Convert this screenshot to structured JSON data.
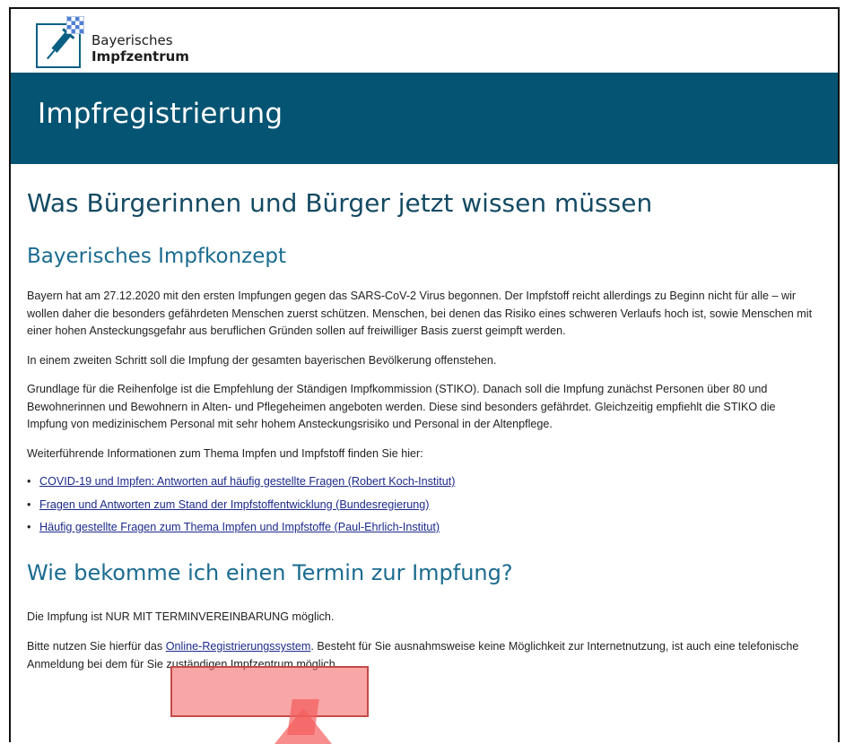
{
  "logo": {
    "line1": "Bayerisches",
    "line2": "Impfzentrum"
  },
  "banner": {
    "title": "Impfregistrierung"
  },
  "main": {
    "heading": "Was Bürgerinnen und Bürger jetzt wissen müssen",
    "section1": {
      "heading": "Bayerisches Impfkonzept",
      "p1": "Bayern hat am 27.12.2020 mit den ersten Impfungen gegen das SARS-CoV-2 Virus begonnen. Der Impfstoff reicht allerdings zu Beginn nicht für alle – wir wollen daher die besonders gefährdeten Menschen zuerst schützen. Menschen, bei denen das Risiko eines schweren Verlaufs hoch ist, sowie Menschen mit einer hohen Ansteckungsgefahr aus beruflichen Gründen sollen auf freiwilliger Basis zuerst geimpft werden.",
      "p2": "In einem zweiten Schritt soll die Impfung der gesamten bayerischen Bevölkerung offenstehen.",
      "p3": "Grundlage für die Reihenfolge ist die Empfehlung der Ständigen Impfkommission (STIKO). Danach soll die Impfung zunächst Personen über 80 und Bewohnerinnen und Bewohnern in Alten- und Pflegeheimen angeboten werden. Diese sind besonders gefährdet. Gleichzeitig empfiehlt die STIKO die Impfung von medizinischem Personal mit sehr hohem Ansteckungsrisiko und Personal in der Altenpflege.",
      "p4": "Weiterführende Informationen zum Thema Impfen und Impfstoff finden Sie hier:",
      "links": [
        "COVID-19 und Impfen: Antworten auf häufig gestellte Fragen (Robert Koch-Institut)",
        "Fragen und Antworten zum Stand der Impfstoffentwicklung (Bundesregierung)",
        "Häufig gestellte Fragen zum Thema Impfen und Impfstoffe (Paul-Ehrlich-Institut)"
      ]
    },
    "section2": {
      "heading": "Wie bekomme ich einen Termin zur Impfung?",
      "p1": "Die Impfung ist NUR MIT TERMINVEREINBARUNG möglich.",
      "p2_before": "Bitte nutzen Sie hierfür das ",
      "p2_link": "Online-Registrierungssystem",
      "p2_after": ". Besteht für Sie ausnahmsweise keine Möglichkeit zur Internetnutzung, ist auch eine telefonische Anmeldung bei dem für Sie zuständigen Impfzentrum möglich."
    }
  },
  "colors": {
    "banner": "#055473",
    "heading": "#144a63",
    "subheading": "#1a6b90",
    "link": "#1c2a8a",
    "highlight": "#f45c5c"
  }
}
